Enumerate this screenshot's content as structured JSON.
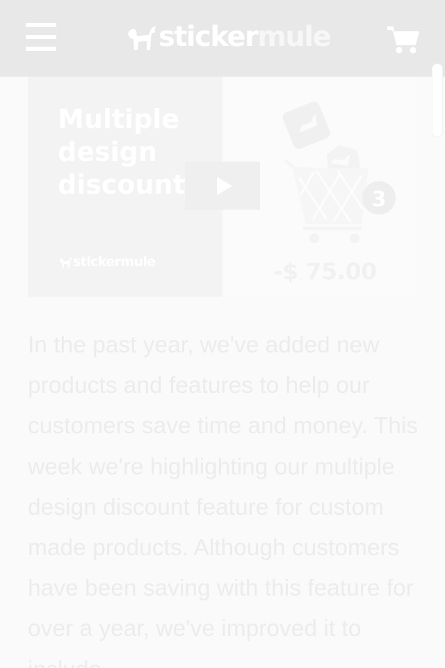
{
  "header": {
    "logo_part1": "sticker",
    "logo_part2": "mule"
  },
  "video": {
    "title": "Multiple\ndesign\ndiscount",
    "brand": "stickermule",
    "price": "-$ 75.00",
    "badge_count": "3"
  },
  "article": {
    "body": "In the past year, we've added new products and features to help our customers save time and money. This week we're highlighting our multiple design discount feature for custom made products. Although customers have been saving with this feature for over a year, we've improved it to include"
  },
  "colors": {
    "header_bg": "#e8e8e8",
    "page_bg": "#fafafa",
    "text": "#ececec"
  },
  "icons": {
    "menu": "hamburger-menu-icon",
    "cart": "shopping-cart-icon",
    "play": "play-icon",
    "logo": "mule-logo-icon"
  }
}
